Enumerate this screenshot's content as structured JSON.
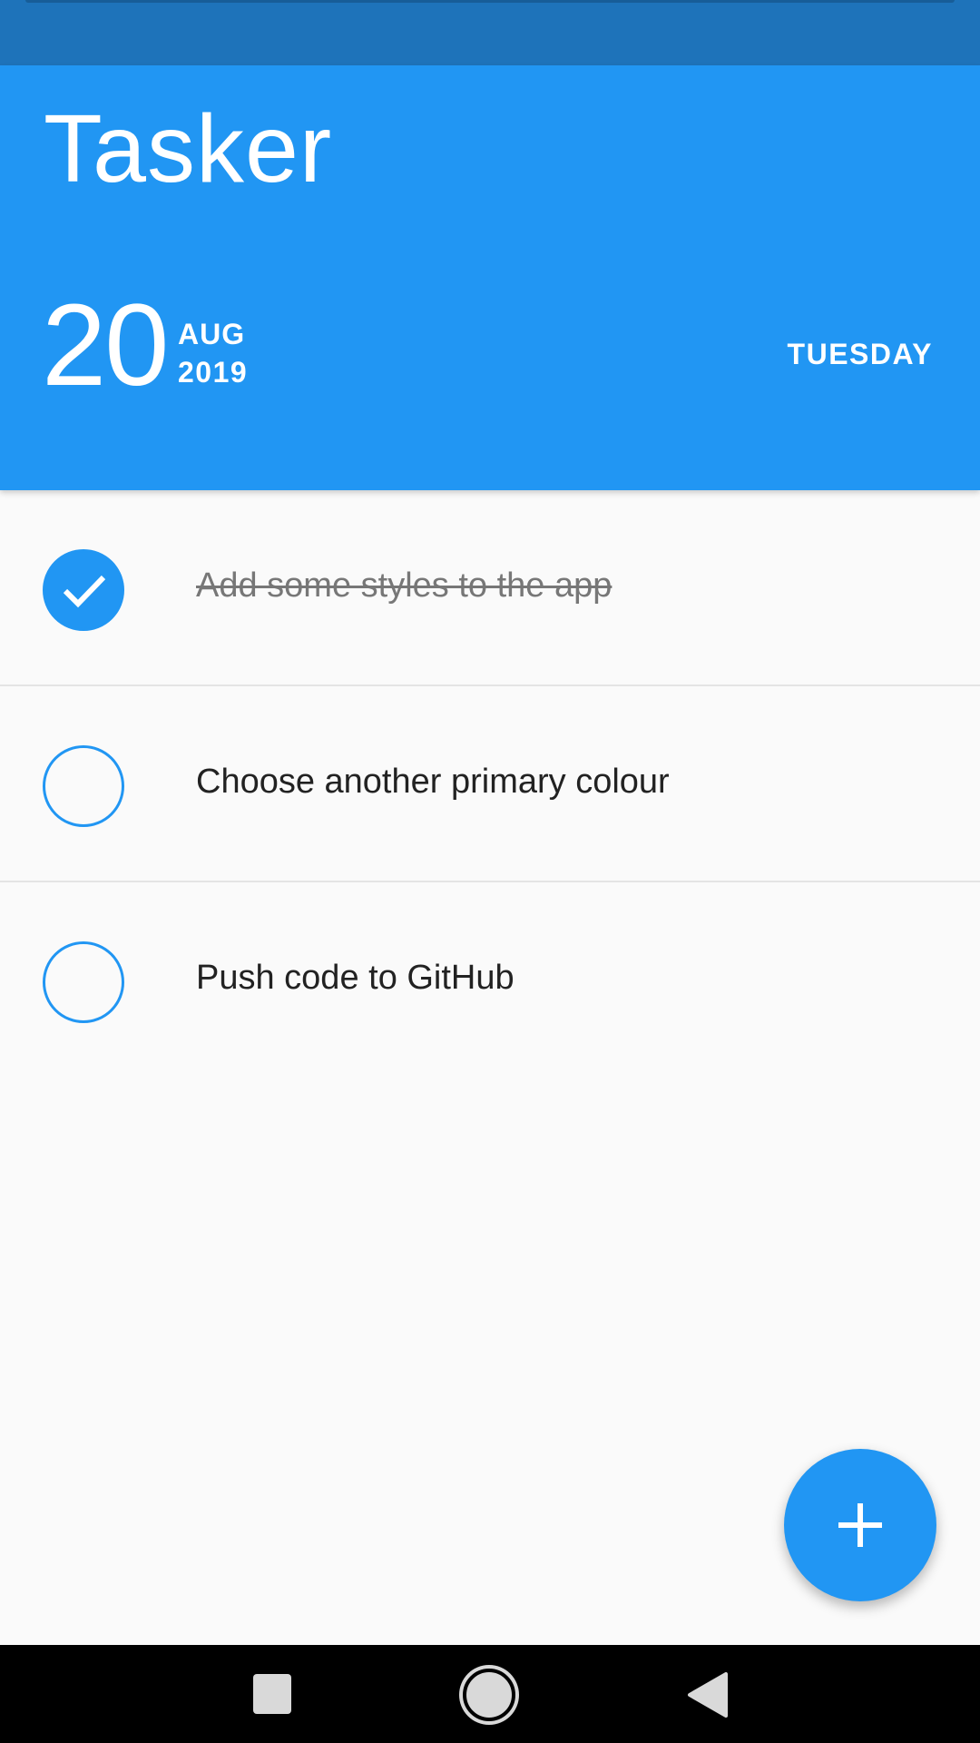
{
  "app": {
    "title": "Tasker"
  },
  "date": {
    "day": "20",
    "month": "AUG",
    "year": "2019",
    "weekday": "TUESDAY"
  },
  "tasks": [
    {
      "text": "Add some styles to the app",
      "done": true
    },
    {
      "text": "Choose another primary colour",
      "done": false
    },
    {
      "text": "Push code to GitHub",
      "done": false
    }
  ],
  "fab": {
    "icon": "plus-icon"
  },
  "nav": {
    "icons": [
      "recents-icon",
      "home-icon",
      "back-icon"
    ]
  },
  "colors": {
    "primary": "#2196f3",
    "status_bar": "#1e73ba",
    "background": "#fafafa"
  }
}
